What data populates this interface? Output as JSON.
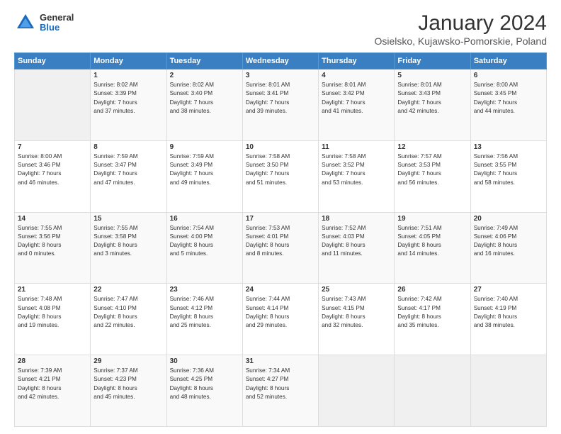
{
  "header": {
    "logo": {
      "general": "General",
      "blue": "Blue"
    },
    "title": "January 2024",
    "subtitle": "Osielsko, Kujawsko-Pomorskie, Poland"
  },
  "days_of_week": [
    "Sunday",
    "Monday",
    "Tuesday",
    "Wednesday",
    "Thursday",
    "Friday",
    "Saturday"
  ],
  "weeks": [
    [
      {
        "day": "",
        "content": ""
      },
      {
        "day": "1",
        "content": "Sunrise: 8:02 AM\nSunset: 3:39 PM\nDaylight: 7 hours\nand 37 minutes."
      },
      {
        "day": "2",
        "content": "Sunrise: 8:02 AM\nSunset: 3:40 PM\nDaylight: 7 hours\nand 38 minutes."
      },
      {
        "day": "3",
        "content": "Sunrise: 8:01 AM\nSunset: 3:41 PM\nDaylight: 7 hours\nand 39 minutes."
      },
      {
        "day": "4",
        "content": "Sunrise: 8:01 AM\nSunset: 3:42 PM\nDaylight: 7 hours\nand 41 minutes."
      },
      {
        "day": "5",
        "content": "Sunrise: 8:01 AM\nSunset: 3:43 PM\nDaylight: 7 hours\nand 42 minutes."
      },
      {
        "day": "6",
        "content": "Sunrise: 8:00 AM\nSunset: 3:45 PM\nDaylight: 7 hours\nand 44 minutes."
      }
    ],
    [
      {
        "day": "7",
        "content": "Sunrise: 8:00 AM\nSunset: 3:46 PM\nDaylight: 7 hours\nand 46 minutes."
      },
      {
        "day": "8",
        "content": "Sunrise: 7:59 AM\nSunset: 3:47 PM\nDaylight: 7 hours\nand 47 minutes."
      },
      {
        "day": "9",
        "content": "Sunrise: 7:59 AM\nSunset: 3:49 PM\nDaylight: 7 hours\nand 49 minutes."
      },
      {
        "day": "10",
        "content": "Sunrise: 7:58 AM\nSunset: 3:50 PM\nDaylight: 7 hours\nand 51 minutes."
      },
      {
        "day": "11",
        "content": "Sunrise: 7:58 AM\nSunset: 3:52 PM\nDaylight: 7 hours\nand 53 minutes."
      },
      {
        "day": "12",
        "content": "Sunrise: 7:57 AM\nSunset: 3:53 PM\nDaylight: 7 hours\nand 56 minutes."
      },
      {
        "day": "13",
        "content": "Sunrise: 7:56 AM\nSunset: 3:55 PM\nDaylight: 7 hours\nand 58 minutes."
      }
    ],
    [
      {
        "day": "14",
        "content": "Sunrise: 7:55 AM\nSunset: 3:56 PM\nDaylight: 8 hours\nand 0 minutes."
      },
      {
        "day": "15",
        "content": "Sunrise: 7:55 AM\nSunset: 3:58 PM\nDaylight: 8 hours\nand 3 minutes."
      },
      {
        "day": "16",
        "content": "Sunrise: 7:54 AM\nSunset: 4:00 PM\nDaylight: 8 hours\nand 5 minutes."
      },
      {
        "day": "17",
        "content": "Sunrise: 7:53 AM\nSunset: 4:01 PM\nDaylight: 8 hours\nand 8 minutes."
      },
      {
        "day": "18",
        "content": "Sunrise: 7:52 AM\nSunset: 4:03 PM\nDaylight: 8 hours\nand 11 minutes."
      },
      {
        "day": "19",
        "content": "Sunrise: 7:51 AM\nSunset: 4:05 PM\nDaylight: 8 hours\nand 14 minutes."
      },
      {
        "day": "20",
        "content": "Sunrise: 7:49 AM\nSunset: 4:06 PM\nDaylight: 8 hours\nand 16 minutes."
      }
    ],
    [
      {
        "day": "21",
        "content": "Sunrise: 7:48 AM\nSunset: 4:08 PM\nDaylight: 8 hours\nand 19 minutes."
      },
      {
        "day": "22",
        "content": "Sunrise: 7:47 AM\nSunset: 4:10 PM\nDaylight: 8 hours\nand 22 minutes."
      },
      {
        "day": "23",
        "content": "Sunrise: 7:46 AM\nSunset: 4:12 PM\nDaylight: 8 hours\nand 25 minutes."
      },
      {
        "day": "24",
        "content": "Sunrise: 7:44 AM\nSunset: 4:14 PM\nDaylight: 8 hours\nand 29 minutes."
      },
      {
        "day": "25",
        "content": "Sunrise: 7:43 AM\nSunset: 4:15 PM\nDaylight: 8 hours\nand 32 minutes."
      },
      {
        "day": "26",
        "content": "Sunrise: 7:42 AM\nSunset: 4:17 PM\nDaylight: 8 hours\nand 35 minutes."
      },
      {
        "day": "27",
        "content": "Sunrise: 7:40 AM\nSunset: 4:19 PM\nDaylight: 8 hours\nand 38 minutes."
      }
    ],
    [
      {
        "day": "28",
        "content": "Sunrise: 7:39 AM\nSunset: 4:21 PM\nDaylight: 8 hours\nand 42 minutes."
      },
      {
        "day": "29",
        "content": "Sunrise: 7:37 AM\nSunset: 4:23 PM\nDaylight: 8 hours\nand 45 minutes."
      },
      {
        "day": "30",
        "content": "Sunrise: 7:36 AM\nSunset: 4:25 PM\nDaylight: 8 hours\nand 48 minutes."
      },
      {
        "day": "31",
        "content": "Sunrise: 7:34 AM\nSunset: 4:27 PM\nDaylight: 8 hours\nand 52 minutes."
      },
      {
        "day": "",
        "content": ""
      },
      {
        "day": "",
        "content": ""
      },
      {
        "day": "",
        "content": ""
      }
    ]
  ]
}
